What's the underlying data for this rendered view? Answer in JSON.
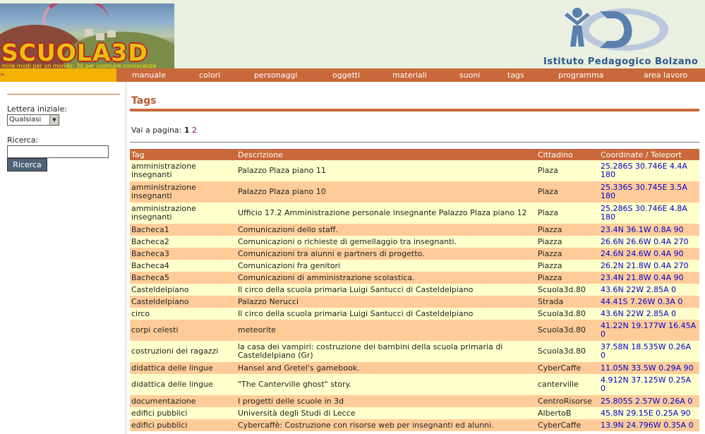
{
  "header": {
    "banner_title": "SCUOLA3D",
    "banner_subtitle": "mille modi per un mondo: 3d per costruire conoscenza",
    "institute": "Istituto Pedagogico Bolzano"
  },
  "nav": {
    "items": [
      "manuale",
      "colori",
      "personaggi",
      "oggetti",
      "materiali",
      "suoni",
      "tags",
      "programma",
      "area lavoro"
    ]
  },
  "sidebar": {
    "letter_label": "Lettera iniziale:",
    "letter_value": "Qualsiasi",
    "search_label": "Ricerca:",
    "search_value": "",
    "search_button": "Ricerca"
  },
  "main": {
    "title": "Tags",
    "pager_label": "Vai a pagina:",
    "pages": [
      "1",
      "2"
    ],
    "columns": [
      "Tag",
      "Descrizione",
      "Cittadino",
      "Coordinate / Teleport"
    ],
    "rows": [
      {
        "tag": "amministrazione insegnanti",
        "desc": "Palazzo Plaza piano 11",
        "citizen": "Plaza",
        "coord": "25.286S 30.746E 4.4A 180"
      },
      {
        "tag": "amministrazione insegnanti",
        "desc": "Palazzo Plaza piano 10",
        "citizen": "Plaza",
        "coord": "25.336S 30.745E 3.5A 180"
      },
      {
        "tag": "amministrazione insegnanti",
        "desc": "Ufficio 17.2 Amministrazione personale insegnante Palazzo Plaza piano 12",
        "citizen": "Plaza",
        "coord": "25.286S 30.746E 4.8A 180"
      },
      {
        "tag": "Bacheca1",
        "desc": "Comunicazioni dello staff.",
        "citizen": "Piazza",
        "coord": "23.4N 36.1W 0.8A 90"
      },
      {
        "tag": "Bacheca2",
        "desc": "Comunicazioni o richieste di gemellaggio tra insegnanti.",
        "citizen": "Piazza",
        "coord": "26.6N 26.6W 0.4A 270"
      },
      {
        "tag": "Bacheca3",
        "desc": "Comunicazioni tra alunni e partners di progetto.",
        "citizen": "Piazza",
        "coord": "24.6N 24.6W 0.4A 90"
      },
      {
        "tag": "Bacheca4",
        "desc": "Comunicazioni fra genitori",
        "citizen": "Piazza",
        "coord": "26.2N 21.8W 0.4A 270"
      },
      {
        "tag": "Bacheca5",
        "desc": "Comunicazioni di amministrazione scolastica.",
        "citizen": "Piazza",
        "coord": "23.4N 21.8W 0.4A 90"
      },
      {
        "tag": "Casteldelpiano",
        "desc": "Il circo della scuola primaria Luigi Santucci di Casteldelpiano",
        "citizen": "Scuola3d.80",
        "coord": "43.6N 22W 2.85A 0"
      },
      {
        "tag": "Casteldelpiano",
        "desc": "Palazzo Nerucci",
        "citizen": "Strada",
        "coord": "44.41S 7.26W 0.3A 0"
      },
      {
        "tag": "circo",
        "desc": "Il circo della scuola primaria Luigi Santucci di Casteldelpiano",
        "citizen": "Scuola3d.80",
        "coord": "43.6N 22W 2.85A 0"
      },
      {
        "tag": "corpi celesti",
        "desc": "meteorite",
        "citizen": "Scuola3d.80",
        "coord": "41.22N 19.177W 16.45A 0"
      },
      {
        "tag": "costruzioni dei ragazzi",
        "desc": "la casa dei vampiri: costruzione dei bambini della scuola primaria di Casteldelpiano (Gr)",
        "citizen": "Scuola3d.80",
        "coord": "37.58N 18.535W 0.26A 0"
      },
      {
        "tag": "didattica delle lingue",
        "desc": "Hansel and Gretel's gamebook.",
        "citizen": "CyberCaffe",
        "coord": "11.05N 33.5W 0.29A 90"
      },
      {
        "tag": "didattica delle lingue",
        "desc": "\"The Canterville ghost\" story.",
        "citizen": "canterville",
        "coord": "4.912N 37.125W 0.25A 0"
      },
      {
        "tag": "documentazione",
        "desc": "I progetti delle scuole in 3d",
        "citizen": "CentroRisorse",
        "coord": "25.805S 2.57W 0.26A 0"
      },
      {
        "tag": "edifici pubblici",
        "desc": "Università degli Studi di Lecce",
        "citizen": "AlbertoB",
        "coord": "45.8N 29.15E 0.25A 90"
      },
      {
        "tag": "edifici pubblici",
        "desc": "Cybercaffè: Costruzione con risorse web per insegnanti ed alunni.",
        "citizen": "CyberCaffe",
        "coord": "13.9N 24.796W 0.35A 0"
      }
    ]
  }
}
